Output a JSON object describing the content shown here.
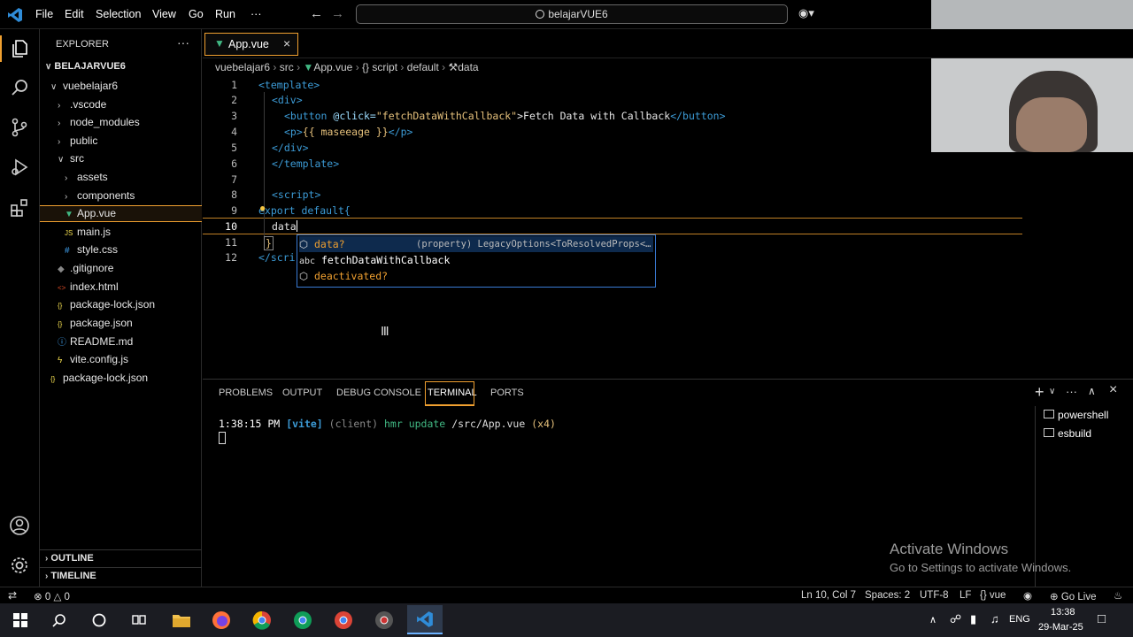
{
  "menu": {
    "items": [
      "File",
      "Edit",
      "Selection",
      "View",
      "Go",
      "Run",
      "···"
    ],
    "search_text": "belajarVUE6"
  },
  "explorer": {
    "title": "EXPLORER",
    "root": "BELAJARVUE6",
    "items": [
      {
        "label": "vuebelajar6",
        "kind": "folder-open",
        "indent": 1
      },
      {
        "label": ".vscode",
        "kind": "folder",
        "indent": 2
      },
      {
        "label": "node_modules",
        "kind": "folder",
        "indent": 2
      },
      {
        "label": "public",
        "kind": "folder",
        "indent": 2
      },
      {
        "label": "src",
        "kind": "folder-open",
        "indent": 2
      },
      {
        "label": "assets",
        "kind": "folder",
        "indent": 3
      },
      {
        "label": "components",
        "kind": "folder",
        "indent": 3
      },
      {
        "label": "App.vue",
        "kind": "vue",
        "indent": 3
      },
      {
        "label": "main.js",
        "kind": "js",
        "indent": 3
      },
      {
        "label": "style.css",
        "kind": "css",
        "indent": 3
      },
      {
        "label": ".gitignore",
        "kind": "git",
        "indent": 2
      },
      {
        "label": "index.html",
        "kind": "html",
        "indent": 2
      },
      {
        "label": "package-lock.json",
        "kind": "json",
        "indent": 2
      },
      {
        "label": "package.json",
        "kind": "json",
        "indent": 2
      },
      {
        "label": "README.md",
        "kind": "info",
        "indent": 2
      },
      {
        "label": "vite.config.js",
        "kind": "vite",
        "indent": 2
      },
      {
        "label": "package-lock.json",
        "kind": "json",
        "indent": 1
      }
    ],
    "outline": "OUTLINE",
    "timeline": "TIMELINE"
  },
  "editor": {
    "tab_label": "App.vue",
    "breadcrumb": [
      "vuebelajar6",
      "src",
      "App.vue",
      "{} script",
      "default",
      "data"
    ],
    "line_numbers": [
      "1",
      "2",
      "3",
      "4",
      "5",
      "6",
      "7",
      "8",
      "9",
      "10",
      "11",
      "12"
    ],
    "lines": {
      "l1": "<template>",
      "l2": "<div>",
      "l3a": "<button ",
      "l3b": "@click=",
      "l3c": "\"fetchDataWithCallback\"",
      "l3d": ">Fetch Data with Callback",
      "l3e": "</button>",
      "l4a": "<p>",
      "l4b": "{{ maseeage }}",
      "l4c": "</p>",
      "l5": "</div>",
      "l6": "</template>",
      "l8": "<script>",
      "l9": "export default{",
      "l10": "data",
      "l11": "}",
      "l12": "</scri"
    },
    "suggestions": [
      {
        "label": "data?",
        "detail": "(property) LegacyOptions<ToResolvedProps<…",
        "icon": "property-icon"
      },
      {
        "label": "fetchDataWithCallback",
        "detail": "",
        "icon": "abc-icon"
      },
      {
        "label": "deactivated?",
        "detail": "",
        "icon": "property-icon"
      }
    ]
  },
  "panel": {
    "tabs": [
      "PROBLEMS",
      "OUTPUT",
      "DEBUG CONSOLE",
      "TERMINAL",
      "PORTS"
    ],
    "active_tab": "TERMINAL",
    "terminal_time": "1:38:15 PM",
    "terminal_vite": "[vite]",
    "terminal_client": "(client)",
    "terminal_hmr": "hmr update",
    "terminal_path": "/src/App.vue",
    "terminal_count": "(x4)",
    "terminals": [
      "powershell",
      "esbuild"
    ]
  },
  "status": {
    "errors": "0",
    "warnings": "0",
    "position": "Ln 10, Col 7",
    "spaces": "Spaces: 2",
    "encoding": "UTF-8",
    "eol": "LF",
    "language": "vue",
    "golive": "Go Live"
  },
  "watermark": {
    "title": "Activate Windows",
    "subtitle": "Go to Settings to activate Windows."
  },
  "taskbar": {
    "lang": "ENG",
    "time": "13:38",
    "date": "29-Mar-25"
  },
  "colors": {
    "accent_orange": "#f0a030",
    "vue_green": "#41b883",
    "suggest_border": "#3a7bd5"
  }
}
